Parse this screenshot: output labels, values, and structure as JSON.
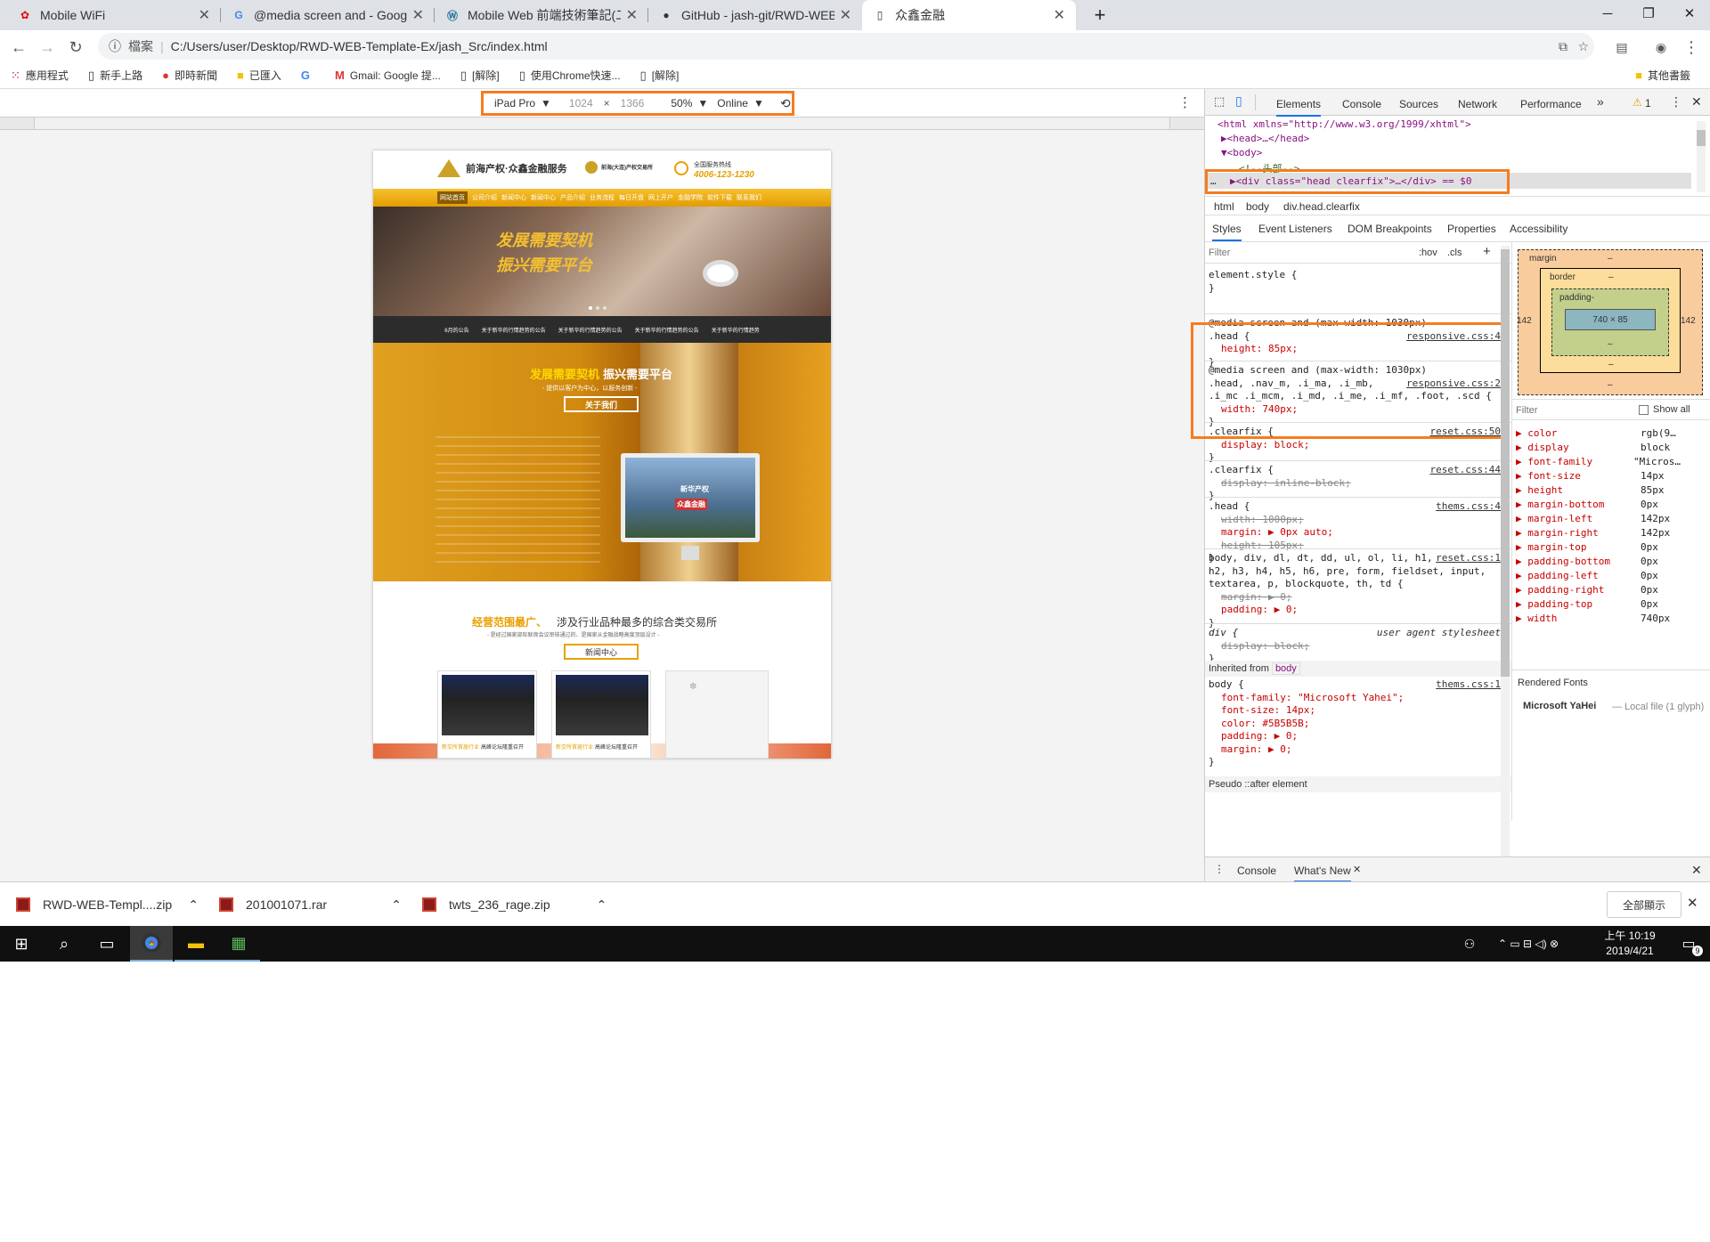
{
  "tabs": [
    {
      "title": "Mobile WiFi",
      "fav": "huawei-icon"
    },
    {
      "title": "@media screen and - Google 搜尋",
      "fav": "google-icon"
    },
    {
      "title": "Mobile Web 前端技術筆記(二):",
      "fav": "wordpress-icon"
    },
    {
      "title": "GitHub - jash-git/RWD-WEB-Te",
      "fav": "github-icon"
    },
    {
      "title": "众鑫金融",
      "fav": "page-icon"
    }
  ],
  "address": {
    "scheme": "檔案",
    "url": "C:/Users/user/Desktop/RWD-WEB-Template-Ex/jash_Src/index.html"
  },
  "bookmarks": [
    "應用程式",
    "新手上路",
    "即時新聞",
    "已匯入",
    "",
    "Gmail: Google 提...",
    "[解除]",
    "使用Chrome快速...",
    "[解除]"
  ],
  "other_bookmarks": "其他書籤",
  "device": {
    "name": "iPad Pro",
    "width": "1024",
    "x": "×",
    "height": "1366",
    "zoom": "50%",
    "network": "Online"
  },
  "site": {
    "logo": "前海产权·众鑫金融服务",
    "logo_sub": "前海(大连)产权交易所",
    "hotline_label": "全国服务热线",
    "hotline": "4006-123-1230",
    "nav": [
      "网站首页",
      "公司介绍",
      "新闻中心",
      "新闻中心",
      "产品介绍",
      "业务流程",
      "每日开盘",
      "网上开户",
      "金融学院",
      "软件下载",
      "联系我们"
    ],
    "banner_text": [
      "发展需要契机",
      "振兴需要平台"
    ],
    "news_strip": [
      "6月的公告",
      "关于新华的行情趋势的公告",
      "关于新华的行情趋势的公告",
      "关于新华的行情趋势的公告",
      "关于新华的行情趋势"
    ],
    "promo_title1": "发展需要契机",
    "promo_title2": "振兴需要平台",
    "promo_sub": "- 提供以客户为中心，以服务创新 -",
    "promo_btn": "关于我们",
    "monitor_text1": "新华产权",
    "monitor_text2": "众鑫金融",
    "scope_t1": "经营范围最广、",
    "scope_t2": "涉及行业品种最多的综合类交易所",
    "scope_sub": "- 是经过国家部际联席会议审核通过的、是国家从金融战略高度顶层设计 -",
    "news_btn": "新闻中心",
    "cards": [
      {
        "cap1": "新交所首届行业",
        "cap2": "高峰论坛隆重召开"
      },
      {
        "cap1": "新交所首届行业",
        "cap2": "高峰论坛隆重召开"
      }
    ]
  },
  "devtools": {
    "tabs": [
      "Elements",
      "Console",
      "Sources",
      "Network",
      "Performance"
    ],
    "warning_count": "1",
    "dom": [
      "<html xmlns=\"http://www.w3.org/1999/xhtml\">",
      "▶<head>…</head>",
      "▼<body>",
      "<!--头部-->",
      "▶<div class=\"head clearfix\">…</div> == $0"
    ],
    "crumbs": [
      "html",
      "body",
      "div.head.clearfix"
    ],
    "style_tabs": [
      "Styles",
      "Event Listeners",
      "DOM Breakpoints",
      "Properties",
      "Accessibility"
    ],
    "filter": "Filter",
    "hov": ":hov",
    "cls": ".cls",
    "rules": [
      {
        "lines": [
          "element.style {",
          "}"
        ]
      },
      {
        "lines": [
          "@media screen and (max-width: 1030px)",
          ".head {",
          "height: 85px;",
          "}"
        ],
        "src": "responsive.css:4"
      },
      {
        "lines": [
          "@media screen and (max-width: 1030px)",
          ".head, .nav_m, .i_ma, .i_mb,",
          ".i_mc .i_mcm, .i_md, .i_me, .i_mf, .foot, .scd {",
          "width: 740px;",
          "}"
        ],
        "src": "responsive.css:2"
      },
      {
        "lines": [
          ".clearfix {",
          "display: block;",
          "}"
        ],
        "src": "reset.css:50"
      },
      {
        "lines": [
          ".clearfix {",
          "display: inline-block;",
          "}"
        ],
        "src": "reset.css:44"
      },
      {
        "lines": [
          ".head {",
          "width: 1000px;",
          "margin: ▶ 0px auto;",
          "height: 105px;",
          "}"
        ],
        "src": "thems.css:4"
      },
      {
        "lines": [
          "body, div, dl, dt, dd, ul, ol, li, h1,",
          "h2, h3, h4, h5, h6, pre, form, fieldset, input,",
          "textarea, p, blockquote, th, td {",
          "margin: ▶ 0;",
          "padding: ▶ 0;",
          "}"
        ],
        "src": "reset.css:1"
      },
      {
        "lines": [
          "div {",
          "display: block;",
          "}"
        ],
        "src": "user agent stylesheet"
      },
      {
        "lines": [
          "body {",
          "font-family: \"Microsoft Yahei\";",
          "font-size: 14px;",
          "color: #5B5B5B;",
          "padding: ▶ 0;",
          "margin: ▶ 0;",
          "}"
        ],
        "src": "thems.css:1"
      }
    ],
    "inherited": "Inherited from",
    "inherited_el": "body",
    "pseudo": "Pseudo ::after element",
    "box": {
      "margin": "margin",
      "border": "border",
      "padding": "padding-",
      "content": "740 × 85",
      "side": "142",
      "dash": "–"
    },
    "show_all": "Show all",
    "computed": [
      {
        "k": "color",
        "v": "rgb(9…"
      },
      {
        "k": "display",
        "v": "block"
      },
      {
        "k": "font-family",
        "v": "\"Micros…"
      },
      {
        "k": "font-size",
        "v": "14px"
      },
      {
        "k": "height",
        "v": "85px"
      },
      {
        "k": "margin-bottom",
        "v": "0px"
      },
      {
        "k": "margin-left",
        "v": "142px"
      },
      {
        "k": "margin-right",
        "v": "142px"
      },
      {
        "k": "margin-top",
        "v": "0px"
      },
      {
        "k": "padding-bottom",
        "v": "0px"
      },
      {
        "k": "padding-left",
        "v": "0px"
      },
      {
        "k": "padding-right",
        "v": "0px"
      },
      {
        "k": "padding-top",
        "v": "0px"
      },
      {
        "k": "width",
        "v": "740px"
      }
    ],
    "rendered_fonts": "Rendered Fonts",
    "font_name": "Microsoft YaHei",
    "font_src": "— Local file (1 glyph)",
    "drawer_tabs": [
      "Console",
      "What's New"
    ]
  },
  "downloads": [
    "RWD-WEB-Templ....zip",
    "201001071.rar",
    "twts_236_rage.zip"
  ],
  "show_all_dl": "全部顯示",
  "clock": {
    "time": "上午 10:19",
    "date": "2019/4/21"
  },
  "notif_count": "9"
}
